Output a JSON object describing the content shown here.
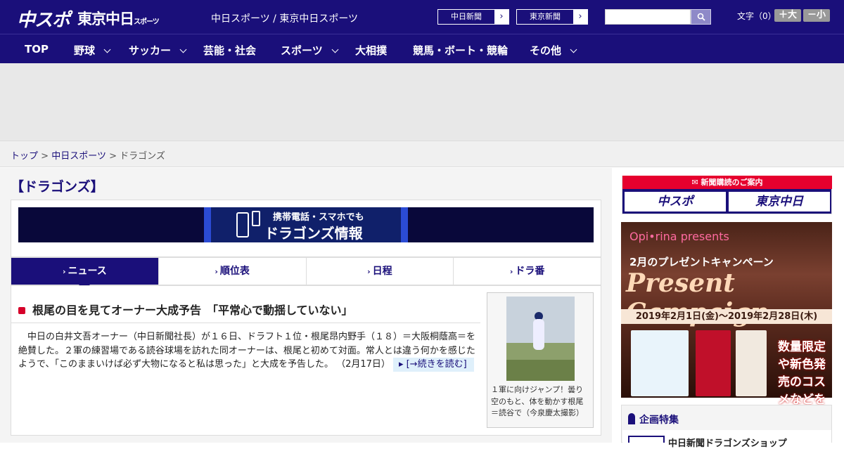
{
  "header": {
    "logo_chuspo": "中スポ",
    "logo_tokyo": "東京中日",
    "logo_tokyo_small": "スポーツ",
    "site_links": "中日スポーツ / 東京中日スポーツ",
    "link_chunichi": "中日新聞",
    "link_tokyo": "東京新聞",
    "search_placeholder": "",
    "font_size_label": "文字（0）",
    "font_bigger": "＋大",
    "font_smaller": "－小"
  },
  "nav": {
    "items": [
      {
        "label": "TOP"
      },
      {
        "label": "野球"
      },
      {
        "label": "サッカー"
      },
      {
        "label": "芸能・社会"
      },
      {
        "label": "スポーツ"
      },
      {
        "label": "大相撲"
      },
      {
        "label": "競馬・ボート・競輪"
      },
      {
        "label": "その他"
      }
    ]
  },
  "breadcrumb": {
    "home": "トップ",
    "section": "中日スポーツ",
    "current": "ドラゴンズ",
    "sep": ">"
  },
  "page": {
    "title": "【ドラゴンズ】"
  },
  "banner": {
    "line1": "携帯電話・スマホでも",
    "line2": "ドラゴンズ情報"
  },
  "tabs": [
    {
      "label": "ニュース"
    },
    {
      "label": "順位表"
    },
    {
      "label": "日程"
    },
    {
      "label": "ドラ番"
    }
  ],
  "article": {
    "title": "根尾の目を見てオーナー大成予告　「平常心で動揺していない」",
    "body": "　中日の白井文吾オーナー（中日新聞社長）が１６日、ドラフト１位・根尾昂内野手（１８）＝大阪桐蔭高＝を絶賛した。２軍の練習場である読谷球場を訪れた同オーナーは、根尾と初めて対面。常人とは違う何かを感じたようで、「このままいけば必ず大物になると私は思った」と大成を予告した。 （2月17日）",
    "read_more": "[→続きを読む]",
    "photo_caption": "１軍に向けジャンプ！曇り空のもと、体を動かす根尾＝読谷で（今泉慶太撮影）"
  },
  "sidebar": {
    "subscribe_header": "新聞購読のご案内",
    "subscribe_logo1": "中スポ",
    "subscribe_logo2": "東京中日",
    "ad_brand": "Opi•rina presents",
    "ad_line1": "2月のプレゼントキャンペーン",
    "ad_line2": "Present Campaign",
    "ad_date": "2019年2月1日(金)～2019年2月28日(木)",
    "ad_promo": "数量限定や新色発売のコスメなどをプレゼント!",
    "feature_title": "企画特集",
    "feature_item": "中日新聞ドラゴンズショップ"
  },
  "colors": {
    "brand_navy": "#1a0f7a",
    "accent_red": "#e6002e"
  }
}
